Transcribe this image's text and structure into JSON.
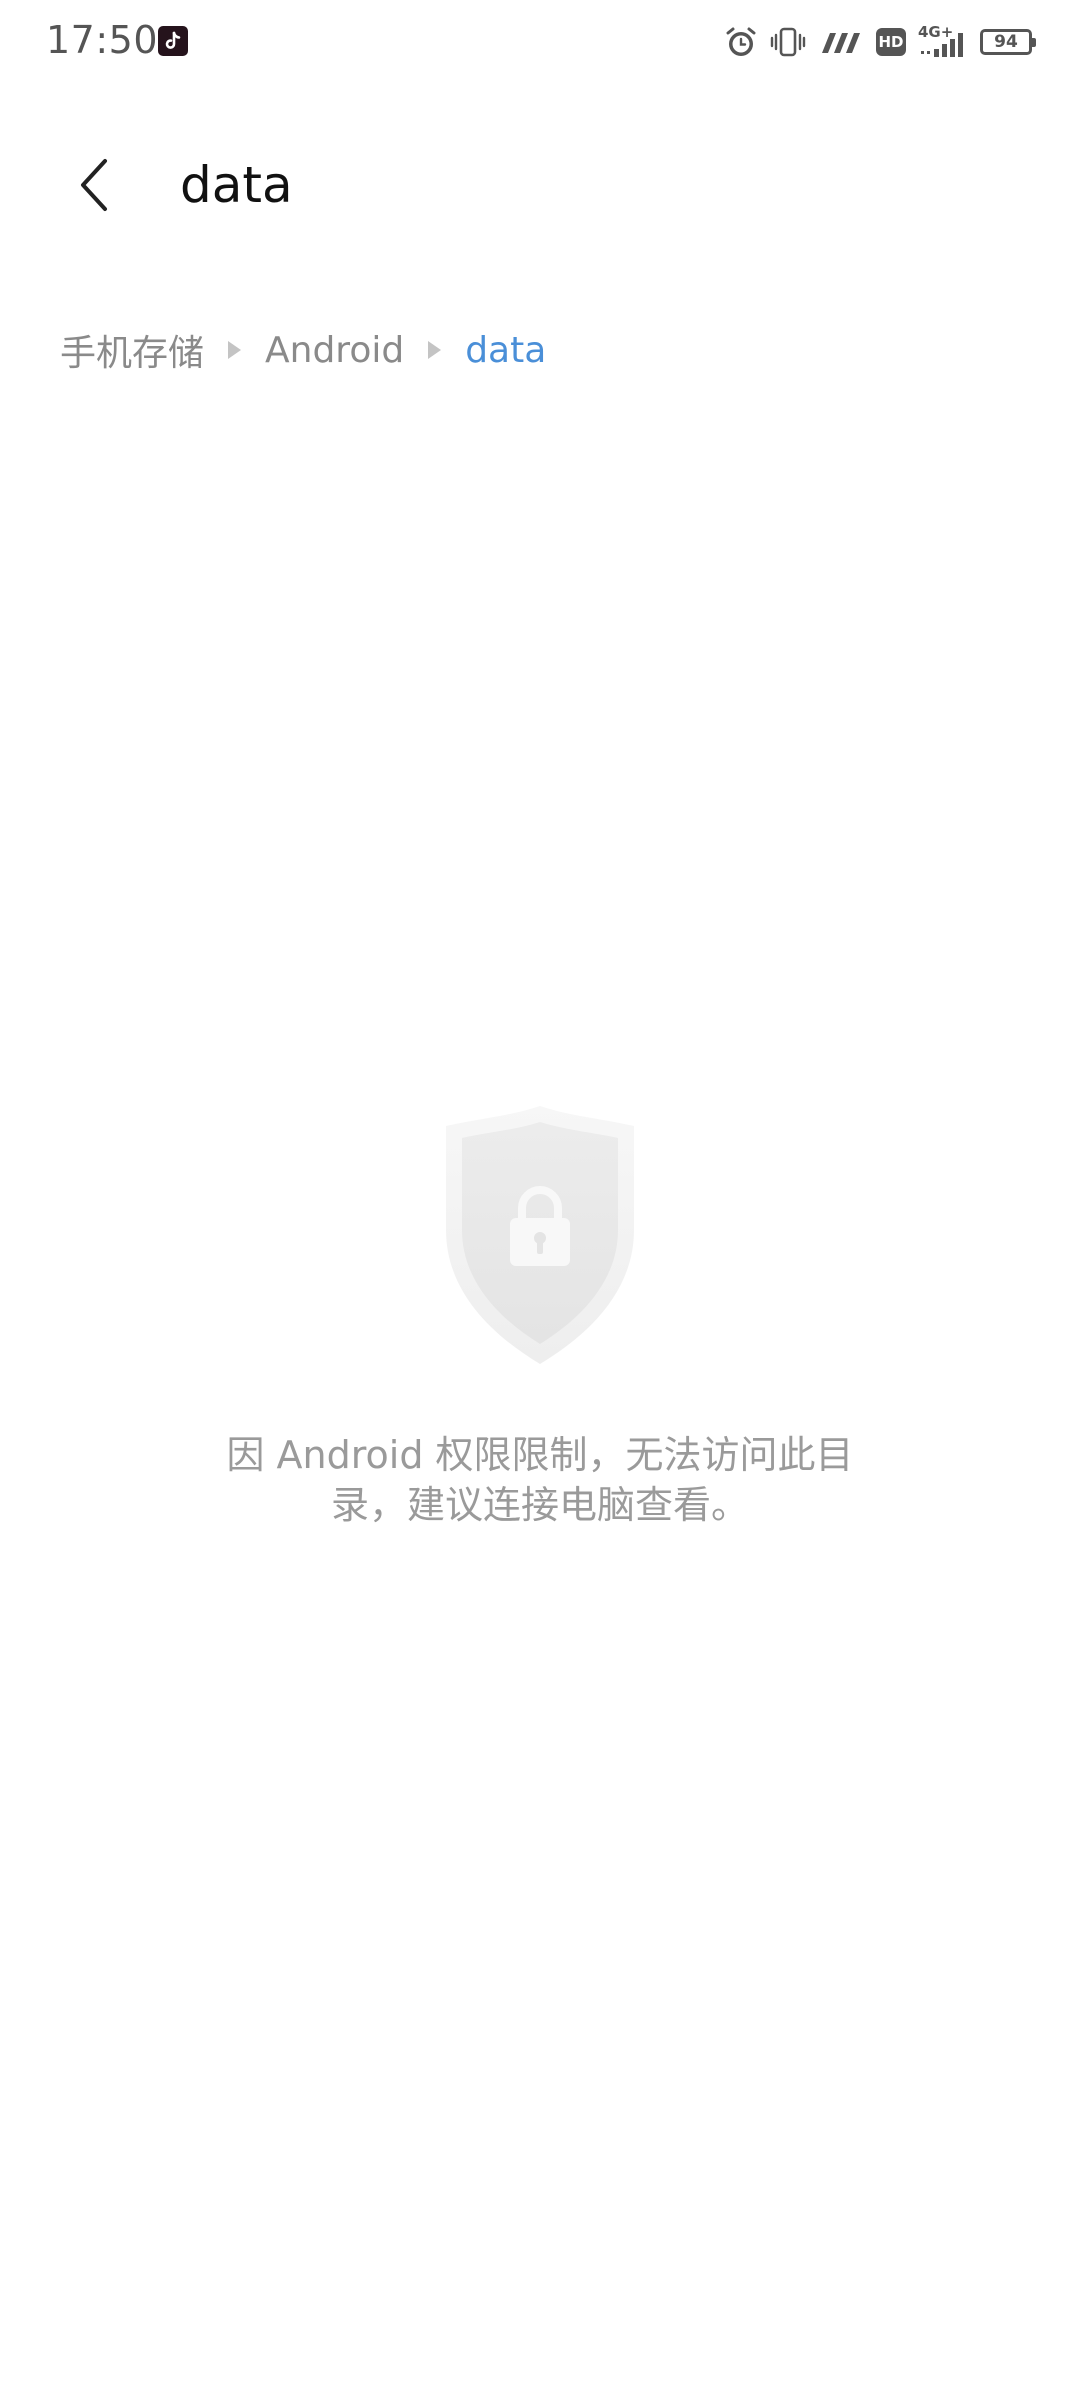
{
  "status_bar": {
    "time": "17:50",
    "battery": "94",
    "network_label": "4G+",
    "hd_label": "HD",
    "icons": [
      "tiktok-notification-icon",
      "alarm-icon",
      "vibrate-icon",
      "signal-icon",
      "hd-icon",
      "4g-signal-icon",
      "battery-icon"
    ]
  },
  "header": {
    "title": "data",
    "back_icon": "chevron-left-icon"
  },
  "breadcrumb": {
    "items": [
      {
        "label": "手机存储"
      },
      {
        "label": "Android"
      },
      {
        "label": "data"
      }
    ],
    "active_color": "#4a8fd8"
  },
  "empty_state": {
    "icon": "shield-lock-icon",
    "message": "因 Android 权限限制，无法访问此目录，建议连接电脑查看。"
  }
}
